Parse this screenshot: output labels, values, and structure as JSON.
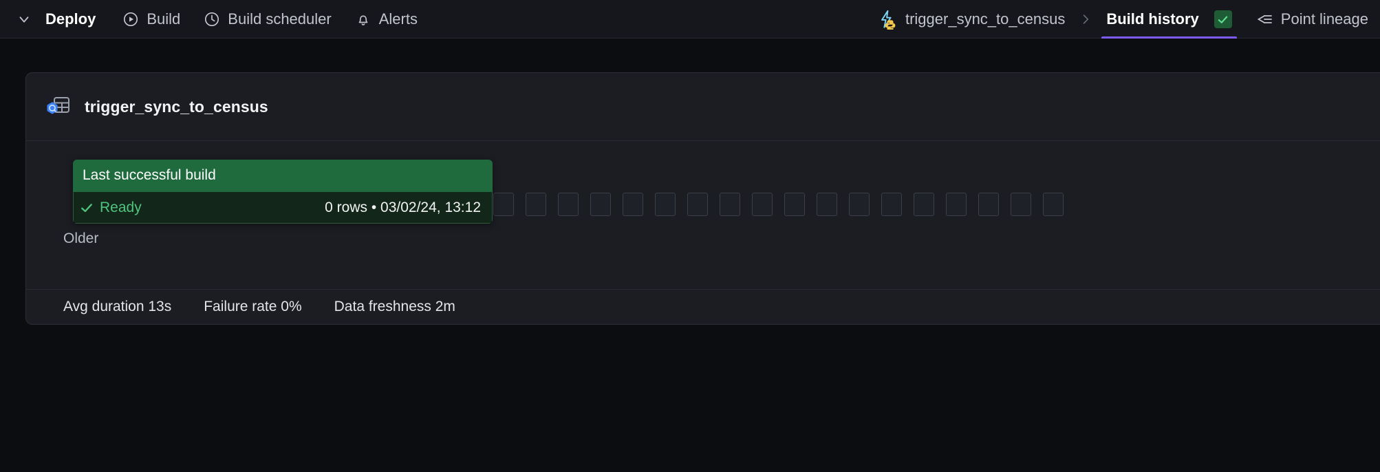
{
  "topbar": {
    "collapse_icon": "chevron-down-icon",
    "left_items": [
      {
        "label": "Deploy",
        "icon": "none",
        "style": "strong"
      },
      {
        "label": "Build",
        "icon": "play-circle-icon",
        "style": "normal"
      },
      {
        "label": "Build scheduler",
        "icon": "clock-icon",
        "style": "normal"
      },
      {
        "label": "Alerts",
        "icon": "bell-icon",
        "style": "normal"
      }
    ],
    "breadcrumb": {
      "icon": "python-lightning-icon",
      "asset": "trigger_sync_to_census",
      "separator": "chevron-right-icon",
      "active_tab": "Build history",
      "status_badge_icon": "check-icon",
      "status_badge_color": "#1d5c35",
      "active_underline_color": "#7c5cfa"
    },
    "lineage": {
      "icon": "lineage-icon",
      "label": "Point lineage"
    }
  },
  "card": {
    "icon": "bigquery-table-icon",
    "title": "trigger_sync_to_census",
    "build_squares_count": 31,
    "popover": {
      "header": "Last successful build",
      "status_icon": "check-icon",
      "status": "Ready",
      "meta": "0 rows • 03/02/24, 13:12",
      "header_bg": "#1f6b3d",
      "body_bg": "#13261a",
      "status_color": "#4ec47e"
    },
    "older_label": "Older",
    "stats": [
      "Avg duration 13s",
      "Failure rate 0%",
      "Data freshness 2m"
    ]
  }
}
